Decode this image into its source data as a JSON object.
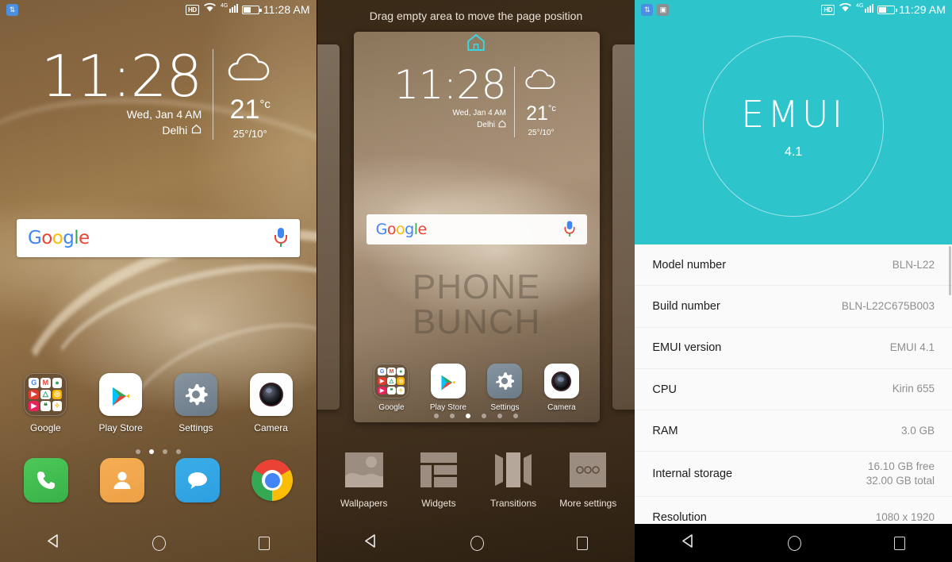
{
  "panel1": {
    "name": "home-screen",
    "statusbar": {
      "sync_icon": "sync-icon",
      "hd_label": "HD",
      "wifi_icon": "wifi-icon",
      "network_label": "4G",
      "signal_icon": "signal-icon",
      "battery_icon": "battery-icon",
      "time": "11:28 AM"
    },
    "clock_widget": {
      "time": "11:28",
      "date": "Wed, Jan 4 AM",
      "city": "Delhi",
      "home_icon": "home-icon",
      "weather_icon": "cloud-icon",
      "temperature": "21",
      "temp_unit": "°c",
      "high_low": "25°/10°"
    },
    "search": {
      "logo": "Google",
      "logo_letters": [
        "G",
        "o",
        "o",
        "g",
        "l",
        "e"
      ],
      "mic_icon": "microphone-icon"
    },
    "apps": [
      {
        "label": "Google",
        "icon": "google-folder-icon"
      },
      {
        "label": "Play Store",
        "icon": "play-store-icon"
      },
      {
        "label": "Settings",
        "icon": "settings-gear-icon"
      },
      {
        "label": "Camera",
        "icon": "camera-icon"
      }
    ],
    "page_dots": {
      "count": 4,
      "active_index": 1
    },
    "dock": [
      {
        "label": "Phone",
        "icon": "phone-icon"
      },
      {
        "label": "Contacts",
        "icon": "contacts-icon"
      },
      {
        "label": "Messaging",
        "icon": "message-icon"
      },
      {
        "label": "Chrome",
        "icon": "chrome-icon"
      }
    ],
    "navbar": {
      "back": "back-icon",
      "home": "home-circle-icon",
      "recents": "recents-icon"
    }
  },
  "panel2": {
    "name": "home-screen-edit-mode",
    "hint": "Drag empty area to move the page position",
    "home_marker_icon": "home-page-icon",
    "clock_widget": {
      "time": "11:28",
      "date": "Wed, Jan 4 AM",
      "city": "Delhi",
      "temperature": "21",
      "temp_unit": "°c",
      "high_low": "25°/10°"
    },
    "search": {
      "logo": "Google",
      "mic_icon": "microphone-icon"
    },
    "watermark": {
      "line1": "PHONE",
      "line2": "BUNCH"
    },
    "apps": [
      {
        "label": "Google",
        "icon": "google-folder-icon"
      },
      {
        "label": "Play Store",
        "icon": "play-store-icon"
      },
      {
        "label": "Settings",
        "icon": "settings-gear-icon"
      },
      {
        "label": "Camera",
        "icon": "camera-icon"
      }
    ],
    "page_dots": {
      "count": 6,
      "active_index": 2
    },
    "tools": [
      {
        "label": "Wallpapers",
        "icon": "wallpapers-icon"
      },
      {
        "label": "Widgets",
        "icon": "widgets-icon"
      },
      {
        "label": "Transitions",
        "icon": "transitions-icon"
      },
      {
        "label": "More settings",
        "icon": "more-settings-icon"
      }
    ],
    "navbar": {
      "back": "back-icon",
      "home": "home-circle-icon",
      "recents": "recents-icon"
    }
  },
  "panel3": {
    "name": "about-phone-screen",
    "statusbar": {
      "sync_icon": "sync-icon",
      "screenshot_icon": "screenshot-icon",
      "hd_label": "HD",
      "wifi_icon": "wifi-icon",
      "network_label": "4G",
      "signal_icon": "signal-icon",
      "battery_icon": "battery-icon",
      "time": "11:29 AM"
    },
    "hero": {
      "brand": "EMUI",
      "version": "4.1",
      "bg_color": "#2ec4cb"
    },
    "rows": [
      {
        "key": "Model number",
        "value": "BLN-L22"
      },
      {
        "key": "Build number",
        "value": "BLN-L22C675B003"
      },
      {
        "key": "EMUI version",
        "value": "EMUI 4.1"
      },
      {
        "key": "CPU",
        "value": "Kirin 655"
      },
      {
        "key": "RAM",
        "value": "3.0 GB"
      },
      {
        "key": "Internal storage",
        "value": "16.10  GB free\n32.00  GB total"
      },
      {
        "key": "Resolution",
        "value": "1080 x 1920"
      }
    ],
    "navbar": {
      "back": "back-icon",
      "home": "home-circle-icon",
      "recents": "recents-icon"
    }
  }
}
